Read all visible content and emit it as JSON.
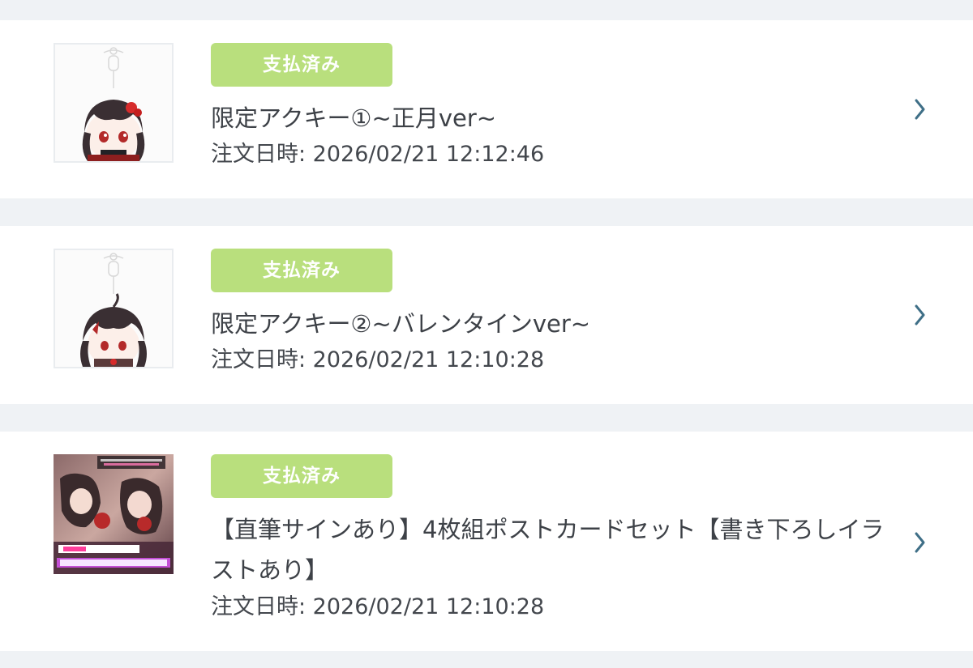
{
  "orders": [
    {
      "status": "支払済み",
      "title": "限定アクキー①~正月ver~",
      "date": "注文日時: 2026/02/21 12:12:46"
    },
    {
      "status": "支払済み",
      "title": "限定アクキー②~バレンタインver~",
      "date": "注文日時: 2026/02/21 12:10:28"
    },
    {
      "status": "支払済み",
      "title": "【直筆サインあり】4枚組ポストカードセット【書き下ろしイラストあり】",
      "date": "注文日時: 2026/02/21 12:10:28"
    }
  ],
  "icons": {
    "chevron": "chevron-right-icon"
  },
  "colors": {
    "background": "#eff2f5",
    "card": "#ffffff",
    "badge": "#b9df7d",
    "badge_text": "#ffffff",
    "text": "#3d4147",
    "chevron": "#3f6f87"
  }
}
